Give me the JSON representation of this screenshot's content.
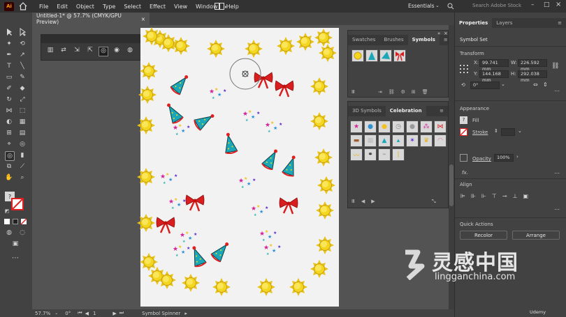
{
  "app": {
    "logo": "Ai",
    "menus": [
      "File",
      "Edit",
      "Object",
      "Type",
      "Select",
      "Effect",
      "View",
      "Window",
      "Help"
    ],
    "workspace": "Essentials",
    "search_placeholder": "Search Adobe Stock"
  },
  "document": {
    "tab_title": "Untitled-1* @ 57.7% (CMYK/GPU Preview)",
    "close_glyph": "×"
  },
  "status": {
    "zoom": "57.7%",
    "angle": "0°",
    "artboard": "1",
    "tool": "Symbol Spinner"
  },
  "swatches_panel": {
    "tabs": [
      "Swatches",
      "Brushes",
      "Symbols"
    ],
    "active_tab": "Symbols"
  },
  "library_panel": {
    "tabs": [
      "3D Symbols",
      "Celebration"
    ],
    "active_tab": "Celebration"
  },
  "properties": {
    "tabs": [
      "Properties",
      "Layers"
    ],
    "active_tab": "Properties",
    "object_type": "Symbol Set",
    "transform_label": "Transform",
    "x_label": "X:",
    "x_value": "99.741 mm",
    "y_label": "Y:",
    "y_value": "144.168 mm",
    "w_label": "W:",
    "w_value": "226.592 mm",
    "h_label": "H:",
    "h_value": "292.038 mm",
    "rotation": "0°",
    "appearance_label": "Appearance",
    "fill_label": "Fill",
    "stroke_label": "Stroke",
    "opacity_label": "Opacity",
    "opacity_value": "100%",
    "fx_label": "fx.",
    "align_label": "Align",
    "quick_actions_label": "Quick Actions",
    "recolor_label": "Recolor",
    "arrange_label": "Arrange"
  },
  "watermark": {
    "brand": "灵感中国",
    "url": "lingganchina.com"
  },
  "udemy": "Udemy",
  "colors": {
    "accent_red": "#e02020",
    "sun_yellow": "#f2d21a",
    "teal_hat": "#1aa6b7"
  },
  "symbols_in_panel": [
    "sun-symbol",
    "party-hat-symbol",
    "party-hat-symbol",
    "red-bow-symbol"
  ]
}
